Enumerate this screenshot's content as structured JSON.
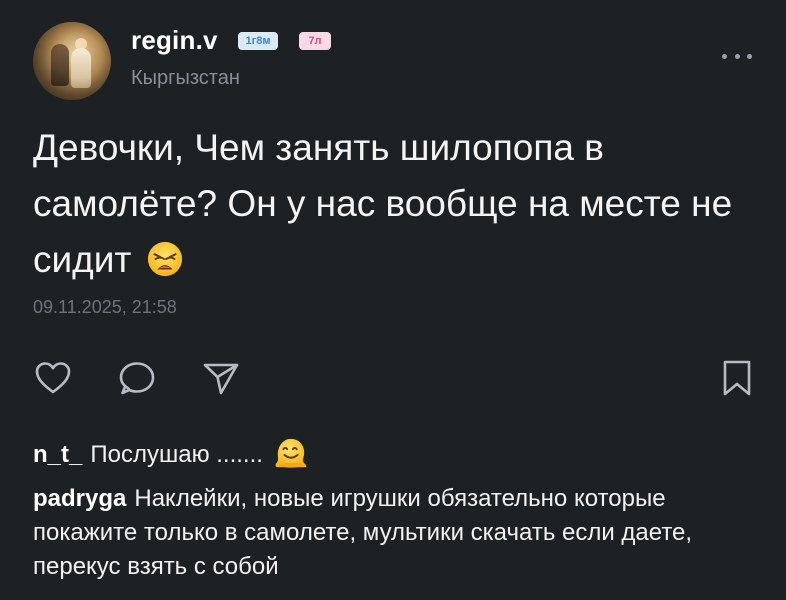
{
  "post": {
    "author": "regin.v",
    "badge_account_age": "1г8м",
    "badge_child_age": "7л",
    "location": "Кыргызстан",
    "text": "Девочки, Чем занять шилопопа в самолёте? Он у нас вообще на месте не сидит",
    "emoji": "weary-face",
    "timestamp": "09.11.2025, 21:58"
  },
  "actions": [
    "like",
    "comment",
    "share",
    "bookmark"
  ],
  "comments": [
    {
      "author": "n_t_",
      "text": "Послушаю .......",
      "emoji": "melting-face"
    },
    {
      "author": "padryga",
      "text": "Наклейки, новые игрушки обязательно которые покажите только в самолете, мультики скачать если даете, перекус взять с собой"
    }
  ],
  "colors": {
    "background": "#1e2124",
    "text": "#f2f2f2",
    "muted": "#8a8f96",
    "badge_blue": "#3a88c9",
    "badge_pink": "#d94b86"
  }
}
